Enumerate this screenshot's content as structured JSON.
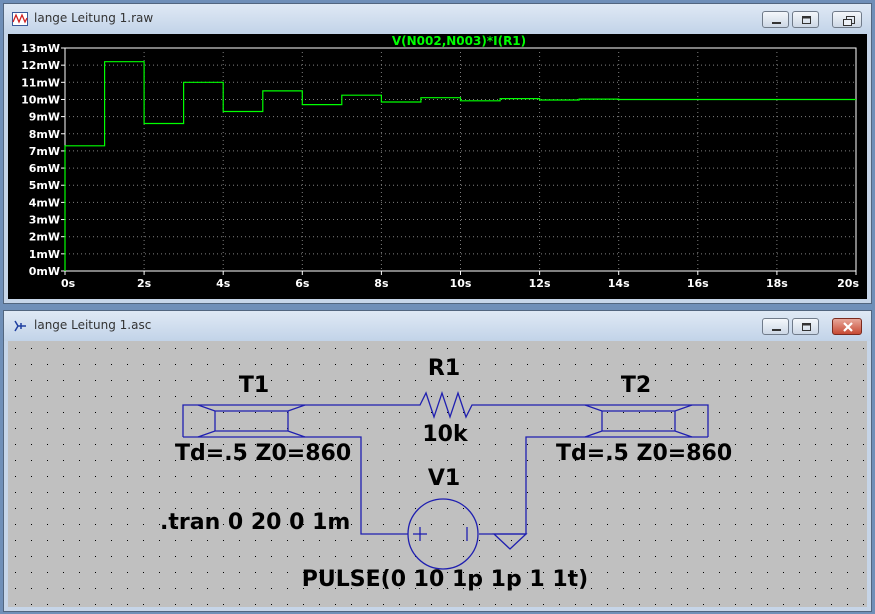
{
  "waveform_window": {
    "title": "lange Leitung 1.raw",
    "trace_label": "V(N002,N003)*I(R1)",
    "colors": {
      "background": "#000000",
      "trace": "#00ff00",
      "axis": "#ffffff",
      "grid": "#7f7f7f"
    }
  },
  "chart_data": {
    "type": "line",
    "title": "V(N002,N003)*I(R1)",
    "xlabel": "",
    "ylabel": "",
    "xlim": [
      0,
      20
    ],
    "ylim": [
      0,
      13
    ],
    "x_ticks": [
      "0s",
      "2s",
      "4s",
      "6s",
      "8s",
      "10s",
      "12s",
      "14s",
      "16s",
      "18s",
      "20s"
    ],
    "y_ticks": [
      "0mW",
      "1mW",
      "2mW",
      "3mW",
      "4mW",
      "5mW",
      "6mW",
      "7mW",
      "8mW",
      "9mW",
      "10mW",
      "11mW",
      "12mW",
      "13mW"
    ],
    "grid": true,
    "series": [
      {
        "name": "V(N002,N003)*I(R1)",
        "step_points": [
          [
            0,
            0
          ],
          [
            0,
            7.3
          ],
          [
            1,
            7.3
          ],
          [
            1,
            12.2
          ],
          [
            2,
            12.2
          ],
          [
            2,
            8.6
          ],
          [
            3,
            8.6
          ],
          [
            3,
            11.0
          ],
          [
            4,
            11.0
          ],
          [
            4,
            9.3
          ],
          [
            5,
            9.3
          ],
          [
            5,
            10.5
          ],
          [
            6,
            10.5
          ],
          [
            6,
            9.7
          ],
          [
            7,
            9.7
          ],
          [
            7,
            10.25
          ],
          [
            8,
            10.25
          ],
          [
            8,
            9.85
          ],
          [
            9,
            9.85
          ],
          [
            9,
            10.1
          ],
          [
            10,
            10.1
          ],
          [
            10,
            9.92
          ],
          [
            11,
            9.92
          ],
          [
            11,
            10.05
          ],
          [
            12,
            10.05
          ],
          [
            12,
            9.97
          ],
          [
            13,
            9.97
          ],
          [
            13,
            10.02
          ],
          [
            14,
            10.02
          ],
          [
            14,
            10.0
          ],
          [
            20,
            10.0
          ]
        ]
      }
    ]
  },
  "schematic_window": {
    "title": "lange Leitung 1.asc",
    "colors": {
      "background": "#c0c0c0",
      "wire": "#1f1fb0",
      "text": "#000000"
    },
    "components": {
      "t1_name": "T1",
      "t1_params": "Td=.5 Z0=860",
      "r1_name": "R1",
      "r1_value": "10k",
      "t2_name": "T2",
      "t2_params": "Td=.5 Z0=860",
      "v1_name": "V1",
      "v1_value": "PULSE(0 10 1p 1p 1 1t)"
    },
    "directive": ".tran 0 20 0 1m"
  },
  "window_controls": {
    "minimize": "minimize-icon",
    "maximize": "maximize-icon",
    "close": "close-icon"
  }
}
